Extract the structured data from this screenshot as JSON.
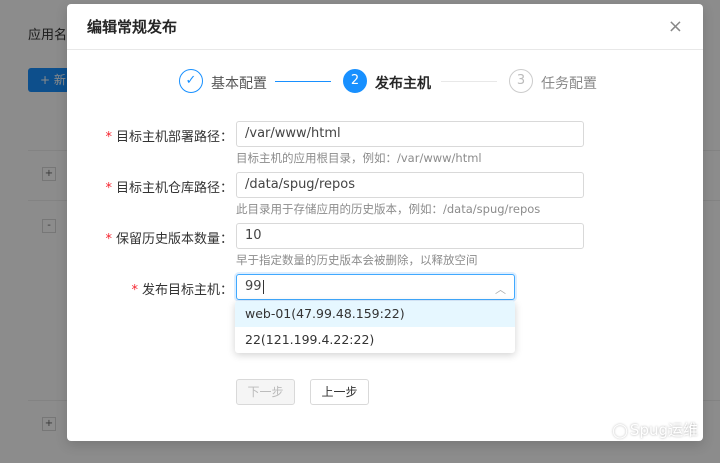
{
  "background": {
    "label": "应用名称",
    "new_button": "+ 新",
    "expanders": [
      "+",
      "-",
      "+"
    ]
  },
  "modal": {
    "title": "编辑常规发布",
    "close_glyph": "×"
  },
  "steps": [
    {
      "index": "✓",
      "label": "基本配置",
      "state": "finished"
    },
    {
      "index": "2",
      "label": "发布主机",
      "state": "active"
    },
    {
      "index": "3",
      "label": "任务配置",
      "state": "wait"
    }
  ],
  "form": {
    "deploy_path": {
      "label": "目标主机部署路径：",
      "value": "/var/www/html",
      "help": "目标主机的应用根目录，例如：/var/www/html"
    },
    "repo_path": {
      "label": "目标主机仓库路径：",
      "value": "/data/spug/repos",
      "help": "此目录用于存储应用的历史版本，例如：/data/spug/repos"
    },
    "versions": {
      "label": "保留历史版本数量：",
      "value": "10",
      "help": "早于指定数量的历史版本会被删除，以释放空间"
    },
    "hosts": {
      "label": "发布目标主机：",
      "value": "99",
      "options": [
        "web-01(47.99.48.159:22)",
        "22(121.199.4.22:22)"
      ]
    },
    "required_mark": "*"
  },
  "buttons": {
    "next": "下一步",
    "prev": "上一步"
  },
  "watermark": {
    "text": "Spug运维",
    "icon": "wechat-icon"
  },
  "colors": {
    "primary": "#1890ff",
    "required": "#f5222d"
  }
}
